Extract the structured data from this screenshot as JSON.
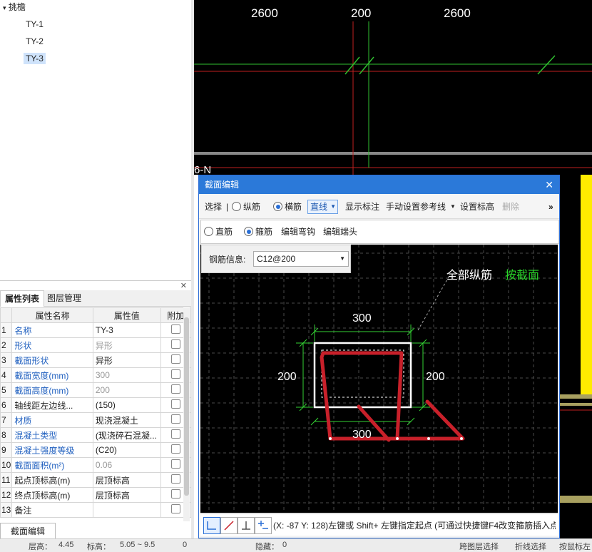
{
  "tree": {
    "root": "挑檐",
    "items": [
      "TY-1",
      "TY-2",
      "TY-3"
    ],
    "selected": "TY-3"
  },
  "cad_top": {
    "dims": [
      "2600",
      "200",
      "2600"
    ],
    "axis_label": "6-N"
  },
  "props": {
    "tabs": [
      "属性列表",
      "图层管理"
    ],
    "headers": [
      "属性名称",
      "属性值",
      "附加"
    ],
    "rows": [
      {
        "n": "1",
        "name": "名称",
        "value": "TY-3"
      },
      {
        "n": "2",
        "name": "形状",
        "value": "异形"
      },
      {
        "n": "3",
        "name": "截面形状",
        "value": "异形"
      },
      {
        "n": "4",
        "name": "截面宽度(mm)",
        "value": "300"
      },
      {
        "n": "5",
        "name": "截面高度(mm)",
        "value": "200"
      },
      {
        "n": "6",
        "name": "轴线距左边线...",
        "value": "(150)"
      },
      {
        "n": "7",
        "name": "材质",
        "value": "现浇混凝土"
      },
      {
        "n": "8",
        "name": "混凝土类型",
        "value": "(现浇碎石混凝..."
      },
      {
        "n": "9",
        "name": "混凝土强度等级",
        "value": "(C20)"
      },
      {
        "n": "10",
        "name": "截面面积(m²)",
        "value": "0.06"
      },
      {
        "n": "11",
        "name": "起点顶标高(m)",
        "value": "层顶标高"
      },
      {
        "n": "12",
        "name": "终点顶标高(m)",
        "value": "层顶标高"
      },
      {
        "n": "13",
        "name": "备注",
        "value": ""
      }
    ],
    "section_edit_button": "截面编辑"
  },
  "statusbar": {
    "floor_label": "层高：",
    "floor_value": "4.45",
    "elev_label": "标高：",
    "elev_value": "5.05 ~ 9.5",
    "zero": "0",
    "hidden_label": "隐藏：",
    "hidden_value": "0",
    "cross_select": "跨图层选择",
    "polyline_select": "折线选择",
    "more": "按鼠标左"
  },
  "dialog": {
    "title": "截面编辑",
    "toolbar1": {
      "select": "选择",
      "longitudinal": "纵筋",
      "transverse": "横筋",
      "line_mode": "直线",
      "show_dim": "显示标注",
      "manual_ref": "手动设置参考线",
      "set_elev": "设置标高",
      "delete": "删除",
      "more": "»"
    },
    "toolbar2": {
      "straight": "直筋",
      "stirrup": "箍筋",
      "edit_hook": "编辑弯钩",
      "edit_end": "编辑端头"
    },
    "rebar_info_label": "钢筋信息:",
    "rebar_info_value": "C12@200",
    "canvas": {
      "note_white": "全部纵筋",
      "note_green": "按截面",
      "dim_top": "300",
      "dim_left": "200",
      "dim_right": "200",
      "dim_bottom": "300"
    },
    "status_text": "(X: -87 Y: 128)左键或 Shift+ 左键指定起点 (可通过快捷键F4改变箍筋插入点)"
  },
  "colors": {
    "rebar": "#c8202a",
    "dim": "#34d234",
    "accent": "#2b79d9"
  }
}
